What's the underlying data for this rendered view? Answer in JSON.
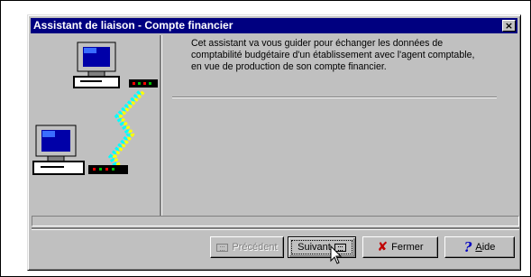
{
  "window": {
    "title": "Assistant de liaison - Compte financier",
    "close_glyph": "×"
  },
  "message": {
    "lines": [
      "Cet assistant va vous guider pour échanger les données de",
      "comptabilité budgétaire d'un établissement avec l'agent comptable,",
      "en vue de production de son compte financier."
    ]
  },
  "buttons": {
    "previous": {
      "label": "Précédent",
      "enabled": false,
      "icon": "keyboard-icon"
    },
    "next": {
      "label": "Suivant",
      "enabled": true,
      "icon": "keyboard-icon"
    },
    "close": {
      "label": "Fermer",
      "icon": "red-x-icon"
    },
    "help": {
      "label_prefix": "",
      "label_underlined": "A",
      "label_rest": "ide",
      "icon": "question-mark-icon"
    }
  },
  "colors": {
    "titlebar": "#000080",
    "face": "#c0c0c0",
    "illustration_link": "#ffff00",
    "illustration_link_2": "#00ffff",
    "screen_blue": "#0000a8"
  }
}
